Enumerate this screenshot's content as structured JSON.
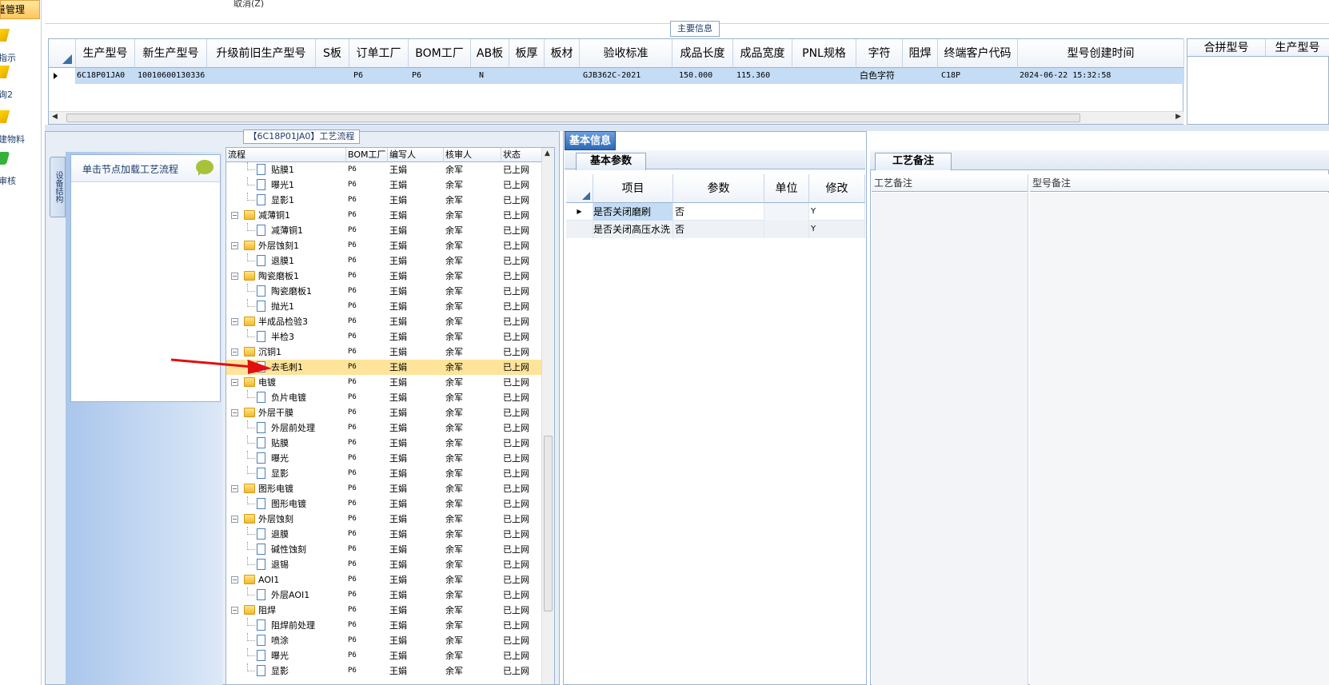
{
  "nav": {
    "active_label": "量管理",
    "items": [
      {
        "label": "指示",
        "icon": "pencil-icon"
      },
      {
        "label": "询2",
        "icon": "pencil-icon"
      },
      {
        "label": "建物料",
        "icon": "pencil-icon"
      },
      {
        "label": "审核",
        "icon": "check-icon"
      }
    ]
  },
  "top": {
    "cancel_label": "取消(Z)",
    "main_info_tab": "主要信息"
  },
  "main_grid": {
    "headers": [
      "生产型号",
      "新生产型号",
      "升级前旧生产型号",
      "S板",
      "订单工厂",
      "BOM工厂",
      "AB板",
      "板厚",
      "板材",
      "验收标准",
      "成品长度",
      "成品宽度",
      "PNL规格",
      "字符",
      "阻焊",
      "终端客户代码",
      "型号创建时间"
    ],
    "row": [
      "6C18P01JA0",
      "10010600130336",
      "",
      "",
      "P6",
      "P6",
      "N",
      "",
      "",
      "GJB362C-2021",
      "150.000",
      "115.360",
      "",
      "白色字符",
      "",
      "C18P",
      "2024-06-22 15:32:58"
    ]
  },
  "right_grid": {
    "headers": [
      "合拼型号",
      "生产型号"
    ]
  },
  "left_panel": {
    "title": "【6C18P01JA0】工艺流程",
    "vtab_label": "设备结构",
    "hint_text": "单击节点加载工艺流程"
  },
  "tree": {
    "headers": [
      "流程",
      "BOM工厂",
      "编写人",
      "核审人",
      "状态"
    ],
    "rows": [
      {
        "label": "贴膜1",
        "type": "doc",
        "bom": "P6",
        "author": "王娟",
        "reviewer": "余军",
        "status": "已上网"
      },
      {
        "label": "曝光1",
        "type": "doc",
        "bom": "P6",
        "author": "王娟",
        "reviewer": "余军",
        "status": "已上网"
      },
      {
        "label": "显影1",
        "type": "doc",
        "bom": "P6",
        "author": "王娟",
        "reviewer": "余军",
        "status": "已上网"
      },
      {
        "label": "减薄铜1",
        "type": "folder",
        "bom": "P6",
        "author": "王娟",
        "reviewer": "余军",
        "status": "已上网"
      },
      {
        "label": "减薄铜1",
        "type": "doc",
        "bom": "P6",
        "author": "王娟",
        "reviewer": "余军",
        "status": "已上网"
      },
      {
        "label": "外层蚀刻1",
        "type": "folder",
        "bom": "P6",
        "author": "王娟",
        "reviewer": "余军",
        "status": "已上网"
      },
      {
        "label": "退膜1",
        "type": "doc",
        "bom": "P6",
        "author": "王娟",
        "reviewer": "余军",
        "status": "已上网"
      },
      {
        "label": "陶瓷磨板1",
        "type": "folder",
        "bom": "P6",
        "author": "王娟",
        "reviewer": "余军",
        "status": "已上网"
      },
      {
        "label": "陶瓷磨板1",
        "type": "doc",
        "bom": "P6",
        "author": "王娟",
        "reviewer": "余军",
        "status": "已上网"
      },
      {
        "label": "抛光1",
        "type": "doc",
        "bom": "P6",
        "author": "王娟",
        "reviewer": "余军",
        "status": "已上网"
      },
      {
        "label": "半成品检验3",
        "type": "folder",
        "bom": "P6",
        "author": "王娟",
        "reviewer": "余军",
        "status": "已上网"
      },
      {
        "label": "半检3",
        "type": "doc",
        "bom": "P6",
        "author": "王娟",
        "reviewer": "余军",
        "status": "已上网"
      },
      {
        "label": "沉铜1",
        "type": "folder",
        "bom": "P6",
        "author": "王娟",
        "reviewer": "余军",
        "status": "已上网"
      },
      {
        "label": "去毛刺1",
        "type": "doc",
        "bom": "P6",
        "author": "王娟",
        "reviewer": "余军",
        "status": "已上网",
        "selected": true
      },
      {
        "label": "电镀",
        "type": "folder",
        "bom": "P6",
        "author": "王娟",
        "reviewer": "余军",
        "status": "已上网"
      },
      {
        "label": "负片电镀",
        "type": "doc",
        "bom": "P6",
        "author": "王娟",
        "reviewer": "余军",
        "status": "已上网"
      },
      {
        "label": "外层干膜",
        "type": "folder",
        "bom": "P6",
        "author": "王娟",
        "reviewer": "余军",
        "status": "已上网"
      },
      {
        "label": "外层前处理",
        "type": "doc",
        "bom": "P6",
        "author": "王娟",
        "reviewer": "余军",
        "status": "已上网"
      },
      {
        "label": "贴膜",
        "type": "doc",
        "bom": "P6",
        "author": "王娟",
        "reviewer": "余军",
        "status": "已上网"
      },
      {
        "label": "曝光",
        "type": "doc",
        "bom": "P6",
        "author": "王娟",
        "reviewer": "余军",
        "status": "已上网"
      },
      {
        "label": "显影",
        "type": "doc",
        "bom": "P6",
        "author": "王娟",
        "reviewer": "余军",
        "status": "已上网"
      },
      {
        "label": "图形电镀",
        "type": "folder",
        "bom": "P6",
        "author": "王娟",
        "reviewer": "余军",
        "status": "已上网"
      },
      {
        "label": "图形电镀",
        "type": "doc",
        "bom": "P6",
        "author": "王娟",
        "reviewer": "余军",
        "status": "已上网"
      },
      {
        "label": "外层蚀刻",
        "type": "folder",
        "bom": "P6",
        "author": "王娟",
        "reviewer": "余军",
        "status": "已上网"
      },
      {
        "label": "退膜",
        "type": "doc",
        "bom": "P6",
        "author": "王娟",
        "reviewer": "余军",
        "status": "已上网"
      },
      {
        "label": "碱性蚀刻",
        "type": "doc",
        "bom": "P6",
        "author": "王娟",
        "reviewer": "余军",
        "status": "已上网"
      },
      {
        "label": "退锡",
        "type": "doc",
        "bom": "P6",
        "author": "王娟",
        "reviewer": "余军",
        "status": "已上网"
      },
      {
        "label": "AOI1",
        "type": "folder",
        "bom": "P6",
        "author": "王娟",
        "reviewer": "余军",
        "status": "已上网"
      },
      {
        "label": "外层AOI1",
        "type": "doc",
        "bom": "P6",
        "author": "王娟",
        "reviewer": "余军",
        "status": "已上网"
      },
      {
        "label": "阻焊",
        "type": "folder",
        "bom": "P6",
        "author": "王娟",
        "reviewer": "余军",
        "status": "已上网"
      },
      {
        "label": "阻焊前处理",
        "type": "doc",
        "bom": "P6",
        "author": "王娟",
        "reviewer": "余军",
        "status": "已上网"
      },
      {
        "label": "喷涂",
        "type": "doc",
        "bom": "P6",
        "author": "王娟",
        "reviewer": "余军",
        "status": "已上网"
      },
      {
        "label": "曝光",
        "type": "doc",
        "bom": "P6",
        "author": "王娟",
        "reviewer": "余军",
        "status": "已上网"
      },
      {
        "label": "显影",
        "type": "doc",
        "bom": "P6",
        "author": "王娟",
        "reviewer": "余军",
        "status": "已上网"
      }
    ]
  },
  "mid_panel": {
    "tab_label": "基本信息",
    "subtab_label": "基本参数",
    "headers": [
      "项目",
      "参数",
      "单位",
      "修改"
    ],
    "rows": [
      {
        "item": "是否关闭磨刷",
        "param": "否",
        "unit": "",
        "modify": "Y"
      },
      {
        "item": "是否关闭高压水洗",
        "param": "否",
        "unit": "",
        "modify": "Y"
      }
    ]
  },
  "right_panel": {
    "tab_label": "工艺备注",
    "proc_note_header": "工艺备注",
    "type_note_header": "型号备注"
  }
}
